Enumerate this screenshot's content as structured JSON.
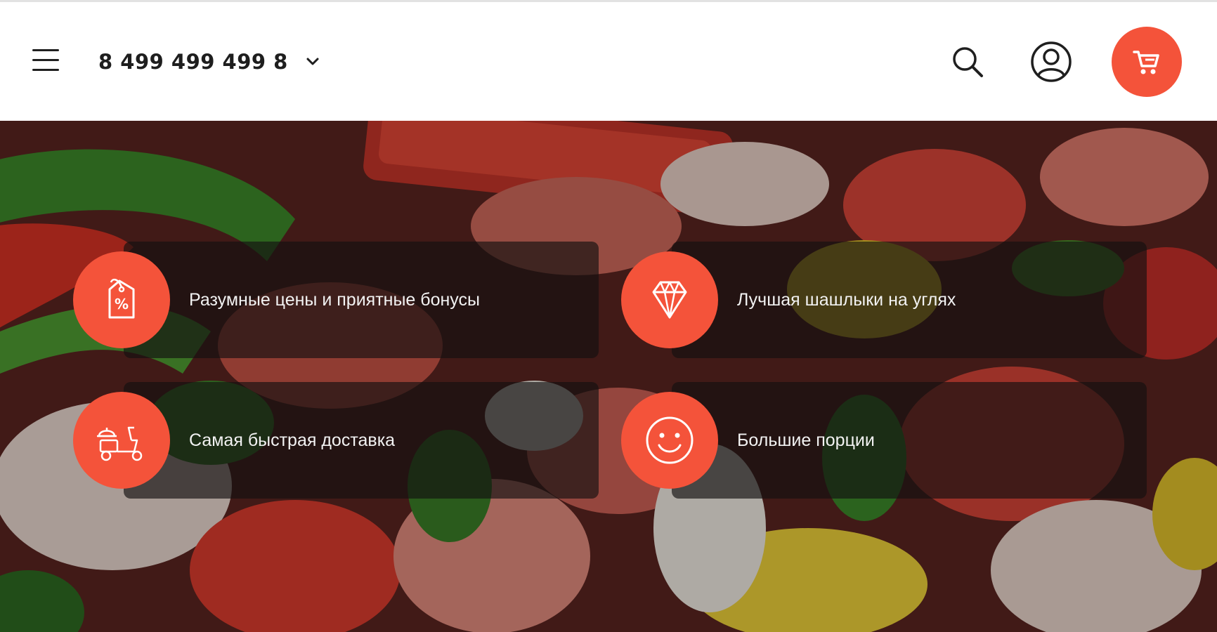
{
  "header": {
    "phone": "8 499 499 499 8",
    "menu_icon": "hamburger-menu-icon",
    "search_icon": "search-icon",
    "account_icon": "user-account-icon",
    "cart_icon": "shopping-cart-icon",
    "accent_color": "#f4533a"
  },
  "hero": {
    "background": "grilled-meat-and-vegetables-photo",
    "features": [
      {
        "icon": "discount-tag-icon",
        "label": "Разумные цены и приятные бонусы"
      },
      {
        "icon": "diamond-icon",
        "label": "Лучшая шашлыки на углях"
      },
      {
        "icon": "delivery-scooter-icon",
        "label": "Самая быстрая доставка"
      },
      {
        "icon": "smiley-face-icon",
        "label": "Большие порции"
      }
    ]
  }
}
